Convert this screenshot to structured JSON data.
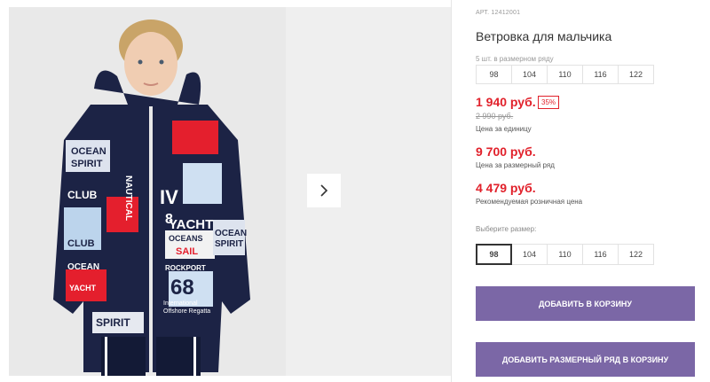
{
  "product": {
    "article": "АРТ. 12412001",
    "title": "Ветровка для мальчика",
    "size_row_caption": "5 шт. в размерном ряду",
    "sizes": [
      "98",
      "104",
      "110",
      "116",
      "122"
    ],
    "selected_size": "98",
    "price": "1 940 руб.",
    "discount": "35%",
    "old_price": "2 990 руб.",
    "price_caption": "Цена за единицу",
    "row_price": "9 700 руб.",
    "row_price_caption": "Цена за размерный ряд",
    "retail_price": "4 479 руб.",
    "retail_price_caption": "Рекомендуемая розничная цена",
    "choose_size_caption": "Выберите размер:",
    "add_to_cart": "ДОБАВИТЬ В КОРЗИНУ",
    "add_row_to_cart": "ДОБАВИТЬ РАЗМЕРНЫЙ РЯД В КОРЗИНУ"
  },
  "photo_print": {
    "words": [
      "OCEAN",
      "SPIRIT",
      "NAUTICAL",
      "CLUB",
      "YACHT",
      "OCEANS",
      "SAIL",
      "ROCKPORT",
      "68",
      "International",
      "Offshore Regatta",
      "YACHT",
      "OCEAN",
      "SPIRIT",
      "OCEAN",
      "SPIRIT",
      "CLUB",
      "IV",
      "8"
    ]
  },
  "gallery": {
    "next_icon": "chevron-right-icon"
  },
  "colors": {
    "accent_red": "#e1212b",
    "button_purple": "#7b67a6",
    "jacket_navy": "#1c2345"
  }
}
